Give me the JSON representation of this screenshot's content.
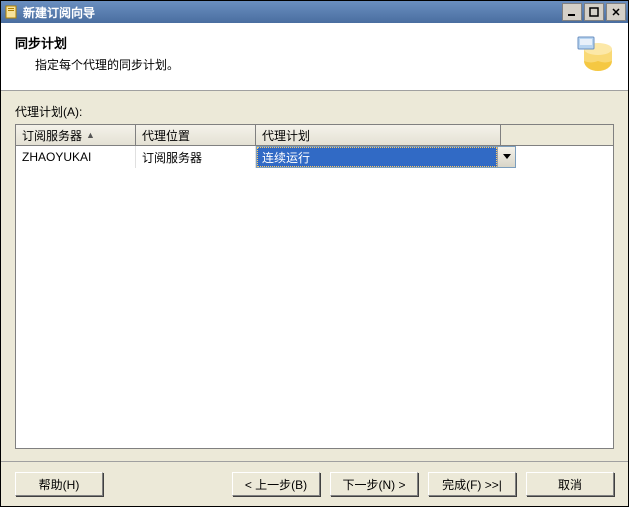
{
  "titlebar": {
    "text": "新建订阅向导"
  },
  "header": {
    "title": "同步计划",
    "subtitle": "指定每个代理的同步计划。"
  },
  "content": {
    "field_label": "代理计划(A):",
    "columns": {
      "c0": "订阅服务器",
      "c1": "代理位置",
      "c2": "代理计划"
    },
    "row": {
      "server": "ZHAOYUKAI",
      "location": "订阅服务器",
      "schedule": "连续运行"
    }
  },
  "footer": {
    "help": "帮助(H)",
    "back": "< 上一步(B)",
    "next": "下一步(N) >",
    "finish": "完成(F) >>|",
    "cancel": "取消"
  }
}
